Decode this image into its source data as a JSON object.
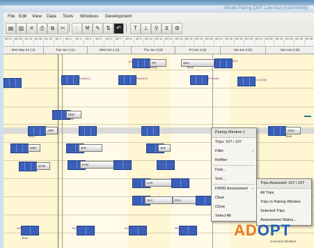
{
  "window": {
    "title": "Altitude Pairing (DMT Calendar) [sub/SW/08]x"
  },
  "menu": [
    "File",
    "Edit",
    "View",
    "Data",
    "Tools",
    "Windows",
    "Development"
  ],
  "toolbar_icons": [
    "select-icon",
    "paste-icon",
    "close-icon",
    "print-icon",
    "copy-icon",
    "cut-icon",
    "split-icon",
    "tools-icon",
    "edit-icon",
    "swap-icon",
    "undo-icon",
    "text-icon",
    "align-icon",
    "pin-icon",
    "filter-icon",
    "gear-icon"
  ],
  "timeline": {
    "hours": [
      "MY 27",
      "MY 28",
      "MY 29",
      "MY 30",
      "MY 31",
      "MY 1",
      "MY 2",
      "MY 3",
      "MY 4",
      "MY 5",
      "MY 6",
      "MY 7",
      "MY 8",
      "MY 9",
      "MY 10",
      "MY 11",
      "MY 12",
      "MY 13",
      "MY 14",
      "MY 15",
      "MY 16",
      "MY 17",
      "MY 18",
      "MY 19",
      "MY 20",
      "MY 21",
      "MY 22",
      "MY 23",
      "MY 24",
      "MY 25",
      "MY 26"
    ],
    "days": [
      "Mon May 31 (-1)",
      "Tue Jun 1 (1)",
      "Wed Jun 2 (2)",
      "Thu Jun 3 (3)",
      "Fri Jun 4 (4)",
      "Sat Jun 5 (5)",
      "Sun Jun 6 (6)"
    ]
  },
  "pairings": [
    {
      "code": "PIT",
      "sub": "23h30",
      "crew": "JFK"
    },
    {
      "code": "SEA",
      "sub": "21h22",
      "crew": "5h26"
    },
    {
      "code": "ORF",
      "sub": "23h04",
      "crew": "1h 5h"
    },
    {
      "code": "DNF",
      "sub": "19h59",
      "crew": "1h 5h"
    },
    {
      "code": "ARP",
      "sub": "23h38",
      "crew": "4h15"
    },
    {
      "code": "JFK",
      "sub": "4h38",
      "crew": "3h"
    },
    {
      "code": "PVD",
      "sub": "16h58",
      "crew": "3h"
    },
    {
      "code": "DTW",
      "sub": "21h32",
      "crew": "3h"
    },
    {
      "code": "JFK",
      "sub": "23h47",
      "crew": "2h"
    },
    {
      "code": "LAX",
      "sub": "19h44",
      "crew": "3h 3h"
    },
    {
      "code": "SLC",
      "sub": "17h32",
      "crew": "4h01"
    },
    {
      "code": "DCA",
      "sub": "19h01",
      "crew": "3h33"
    },
    {
      "code": "GRU",
      "sub": "3h50",
      "crew": "7h"
    },
    {
      "code": "MSP",
      "sub": "2h 4h",
      "crew": "3h44"
    }
  ],
  "labels": [
    "JFK",
    "SEA",
    "ALB(901)",
    "BWI(300)",
    "JFK(840)",
    "SCL(090)",
    "PHX",
    "ATL",
    "SCL",
    "MSP",
    "MSP",
    "MSP",
    "MSP",
    "JFK",
    "ATL",
    "BWI(070)",
    "LGA(850)",
    "ISP"
  ],
  "context_menu": {
    "title": "Pairing Window 1",
    "subtitle": "Trips: 107 / 107",
    "items": [
      "Filter",
      "Refilter",
      "Find...",
      "Sort...",
      "FRMS Assessment",
      "Clear",
      "Close",
      "Select All"
    ],
    "submenu_header": "Trips Assessed: 107 / 107",
    "submenu": [
      "All Trips",
      "Trips in Pairing Window",
      "Selected Trips",
      "Assessment Status..."
    ]
  },
  "logo": {
    "part1": "AD",
    "part2": "OPT",
    "tagline": "A Kronos Division"
  },
  "colors": {
    "accent": "#3b5fb8",
    "brand_orange": "#e97a1c",
    "brand_blue": "#1a62b6"
  }
}
